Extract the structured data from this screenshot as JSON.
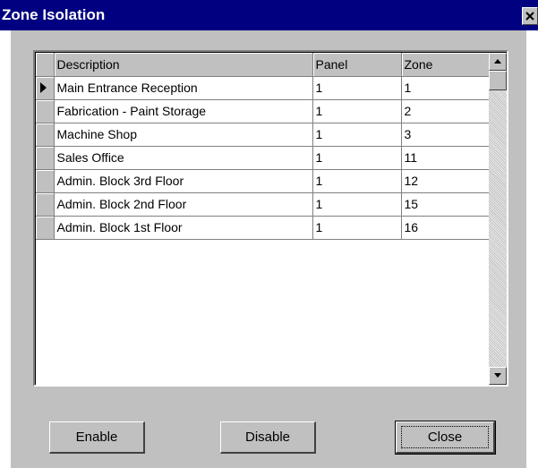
{
  "window": {
    "title": "Zone Isolation",
    "close_icon": "close-icon"
  },
  "grid": {
    "columns": [
      "Description",
      "Panel",
      "Zone"
    ],
    "current_row_index": 0,
    "rows": [
      {
        "description": "Main Entrance Reception",
        "panel": "1",
        "zone": "1"
      },
      {
        "description": "Fabrication - Paint Storage",
        "panel": "1",
        "zone": "2"
      },
      {
        "description": "Machine Shop",
        "panel": "1",
        "zone": "3"
      },
      {
        "description": "Sales Office",
        "panel": "1",
        "zone": "11"
      },
      {
        "description": "Admin. Block 3rd Floor",
        "panel": "1",
        "zone": "12"
      },
      {
        "description": "Admin. Block 2nd Floor",
        "panel": "1",
        "zone": "15"
      },
      {
        "description": "Admin. Block 1st Floor",
        "panel": "1",
        "zone": "16"
      }
    ]
  },
  "buttons": {
    "enable": "Enable",
    "disable": "Disable",
    "close": "Close"
  },
  "colors": {
    "title_bar": "#000080",
    "dialog_face": "#c0c0c0",
    "grid_background": "#ffffff"
  }
}
